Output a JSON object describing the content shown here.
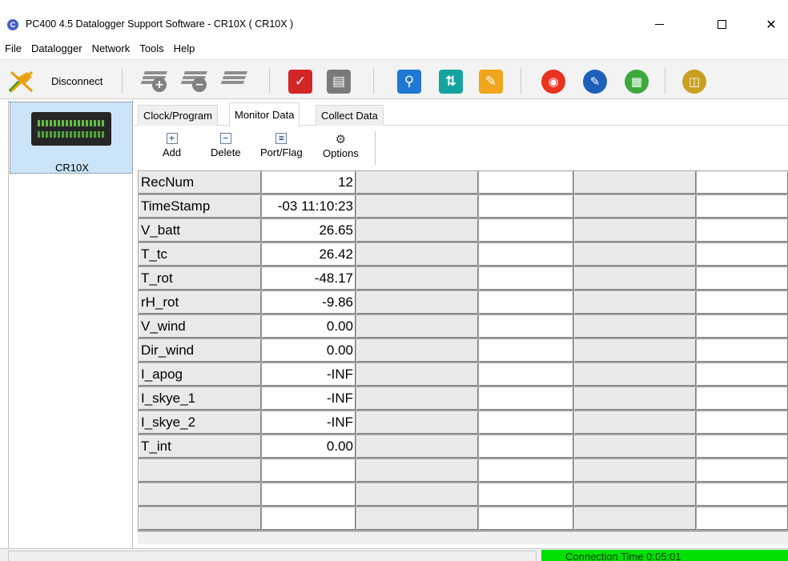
{
  "window": {
    "title": "PC400 4.5 Datalogger Support Software - CR10X ( CR10X )",
    "icon": "pc400-app-icon"
  },
  "menu": [
    "File",
    "Datalogger",
    "Network",
    "Tools",
    "Help"
  ],
  "toolbar": {
    "disconnect_label": "Disconnect"
  },
  "device_list": {
    "items": [
      {
        "label": "CR10X",
        "selected": true
      }
    ]
  },
  "tabs": [
    {
      "label": "Clock/Program",
      "active": false
    },
    {
      "label": "Monitor Data",
      "active": true
    },
    {
      "label": "Collect Data",
      "active": false
    }
  ],
  "monitor_toolbar": {
    "add": "Add",
    "delete": "Delete",
    "port_flag": "Port/Flag",
    "options": "Options"
  },
  "monitor_rows": [
    {
      "name": "RecNum",
      "value": "12"
    },
    {
      "name": "TimeStamp",
      "value": "-03 11:10:23"
    },
    {
      "name": "V_batt",
      "value": "26.65"
    },
    {
      "name": "T_tc",
      "value": "26.42"
    },
    {
      "name": "T_rot",
      "value": "-48.17"
    },
    {
      "name": "rH_rot",
      "value": "-9.86"
    },
    {
      "name": "V_wind",
      "value": "0.00"
    },
    {
      "name": "Dir_wind",
      "value": "0.00"
    },
    {
      "name": "I_apog",
      "value": "-INF"
    },
    {
      "name": "I_skye_1",
      "value": "-INF"
    },
    {
      "name": "I_skye_2",
      "value": "-INF"
    },
    {
      "name": "T_int",
      "value": "0.00"
    },
    {
      "name": "",
      "value": ""
    },
    {
      "name": "",
      "value": ""
    },
    {
      "name": "",
      "value": ""
    }
  ],
  "status": {
    "connection_time": "Connection Time 0:05:01",
    "connection_color": "#00e100"
  }
}
